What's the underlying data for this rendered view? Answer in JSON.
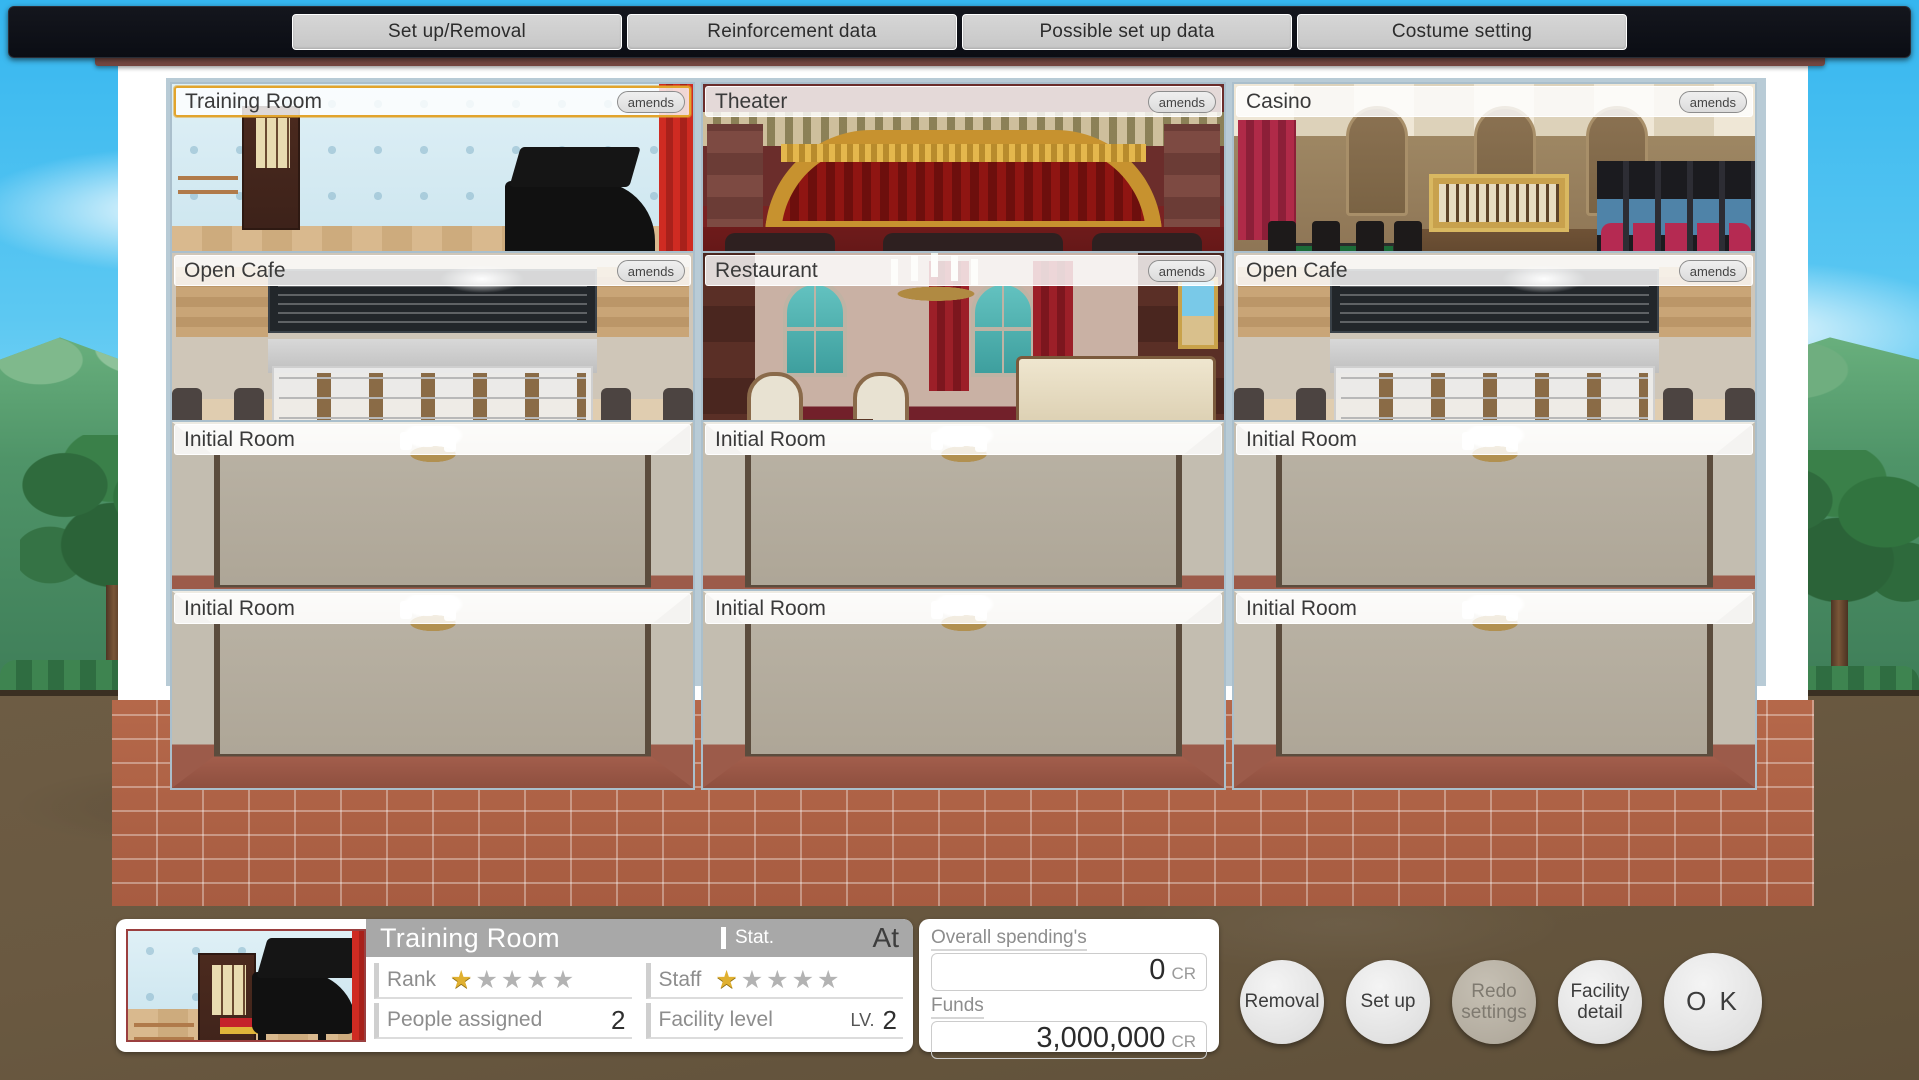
{
  "topbar": {
    "tabs": [
      {
        "label": "Set up/Removal"
      },
      {
        "label": "Reinforcement data"
      },
      {
        "label": "Possible set up data"
      },
      {
        "label": "Costume setting"
      }
    ]
  },
  "amends_label": "amends",
  "floors": [
    {
      "rooms": [
        {
          "name": "Training Room",
          "art": "training",
          "has_amends": true,
          "selected": true
        },
        {
          "name": "Theater",
          "art": "theater",
          "has_amends": true,
          "selected": false
        },
        {
          "name": "Casino",
          "art": "casino",
          "has_amends": true,
          "selected": false
        }
      ]
    },
    {
      "rooms": [
        {
          "name": "Open Cafe",
          "art": "cafe",
          "has_amends": true,
          "selected": false
        },
        {
          "name": "Restaurant",
          "art": "rest",
          "has_amends": true,
          "selected": false
        },
        {
          "name": "Open Cafe",
          "art": "cafe",
          "has_amends": true,
          "selected": false
        }
      ]
    },
    {
      "rooms": [
        {
          "name": "Initial Room",
          "art": "initial",
          "has_amends": false,
          "selected": false
        },
        {
          "name": "Initial Room",
          "art": "initial",
          "has_amends": false,
          "selected": false
        },
        {
          "name": "Initial Room",
          "art": "initial",
          "has_amends": false,
          "selected": false
        }
      ]
    },
    {
      "rooms": [
        {
          "name": "Initial Room",
          "art": "initial",
          "has_amends": false,
          "selected": false
        },
        {
          "name": "Initial Room",
          "art": "initial",
          "has_amends": false,
          "selected": false
        },
        {
          "name": "Initial Room",
          "art": "initial",
          "has_amends": false,
          "selected": false
        }
      ]
    }
  ],
  "info": {
    "room_name": "Training Room",
    "stat_label": "Stat.",
    "stat_value": "At",
    "rank_label": "Rank",
    "rank_stars": 1,
    "rank_stars_max": 5,
    "staff_label": "Staff",
    "staff_stars": 1,
    "staff_stars_max": 5,
    "people_label": "People assigned",
    "people_value": "2",
    "facility_level_label": "Facility level",
    "facility_level_prefix": "LV.",
    "facility_level_value": "2"
  },
  "money": {
    "spending_label": "Overall spending's",
    "spending_value": "0",
    "spending_currency": "CR",
    "funds_label": "Funds",
    "funds_value": "3,000,000",
    "funds_currency": "CR"
  },
  "actions": [
    {
      "label": "Removal",
      "disabled": false,
      "size": "normal"
    },
    {
      "label": "Set up",
      "disabled": false,
      "size": "normal"
    },
    {
      "label": "Redo settings",
      "disabled": true,
      "size": "normal"
    },
    {
      "label": "Facility detail",
      "disabled": false,
      "size": "normal"
    },
    {
      "label": "O K",
      "disabled": false,
      "size": "large"
    }
  ],
  "colors": {
    "accent_selected": "#e2a42c",
    "panel_bg": "#ffffff",
    "titlebar_gray": "#a8a8a8",
    "star_gold": "#e0b030",
    "star_gray": "#b3b3b3",
    "topbar_bg": "#0b0d14",
    "ground_brown": "#6b5b43",
    "sky_blue": "#35b6ef"
  }
}
